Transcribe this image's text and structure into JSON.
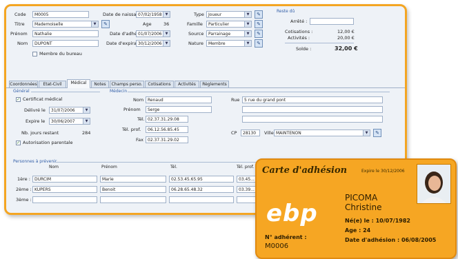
{
  "header": {
    "code_label": "Code",
    "code_value": "M0005",
    "titre_label": "Titre",
    "titre_value": "Mademoiselle",
    "prenom_label": "Prénom",
    "prenom_value": "Nathalie",
    "nom_label": "Nom",
    "nom_value": "DUPONT",
    "membre_bureau_label": "Membre du bureau",
    "naissance_label": "Date de naissance",
    "naissance_value": "07/02/1958",
    "age_label": "Age",
    "age_value": "36",
    "adhesion_label": "Date d'adhésion",
    "adhesion_value": "01/07/2006",
    "expiration_label": "Date d'expiration",
    "expiration_value": "30/12/2006",
    "type_label": "Type",
    "type_value": "Joueur",
    "famille_label": "Famille",
    "famille_value": "Particulier",
    "source_label": "Source",
    "source_value": "Parrainage",
    "nature_label": "Nature",
    "nature_value": "Membre"
  },
  "reste": {
    "title": "Reste dû",
    "arrete_label": "Arrêté :",
    "cotisations_label": "Cotisations :",
    "cotisations_value": "12,00 €",
    "activites_label": "Activités :",
    "activites_value": "20,00 €",
    "solde_label": "Solde :",
    "solde_value": "32,00 €"
  },
  "tabs": [
    "Coordonnées",
    "Etat-Civil",
    "Médical",
    "Notes",
    "Champs perso.",
    "Cotisations",
    "Activités",
    "Règlements"
  ],
  "active_tab": 2,
  "general": {
    "title": "Général",
    "certificat_label": "Certificat médical",
    "delivre_label": "Délivré le",
    "delivre_value": "31/07/2006",
    "expire_label": "Expire le",
    "expire_value": "30/06/2007",
    "jours_label": "Nb. jours restant",
    "jours_value": "284",
    "autorisation_label": "Autorisation parentale"
  },
  "medecin": {
    "title": "Médecin",
    "nom_label": "Nom",
    "nom_value": "Renaud",
    "prenom_label": "Prénom",
    "prenom_value": "Serge",
    "tel_label": "Tél.",
    "tel_value": "02.37.31.29.08",
    "telprof_label": "Tél. prof.",
    "telprof_value": "06.12.56.85.45",
    "fax_label": "Fax",
    "fax_value": "02.37.31.29.02",
    "rue_label": "Rue",
    "rue_value": "5 rue du grand pont",
    "cp_label": "CP",
    "cp_value": "28130",
    "ville_label": "Ville",
    "ville_value": "MAINTENON"
  },
  "prevenir": {
    "title": "Personnes à prévenir",
    "col_nom": "Nom",
    "col_prenom": "Prénom",
    "col_tel": "Tél.",
    "col_telprof": "Tél. prof.",
    "rows": [
      {
        "label": "1ère :",
        "nom": "DURCIM",
        "prenom": "Marie",
        "tel": "02.53.45.65.95",
        "telprof": "03.45..."
      },
      {
        "label": "2ème :",
        "nom": "KUPERS",
        "prenom": "Benoit",
        "tel": "06.28.65.48.32",
        "telprof": "03.39..."
      },
      {
        "label": "3ème :",
        "nom": "",
        "prenom": "",
        "tel": "",
        "telprof": ""
      }
    ]
  },
  "card": {
    "title": "Carte d'adhésion",
    "expire": "Expire le 30/12/2006",
    "logo": "ebp",
    "nom": "PICOMA",
    "prenom": "Christine",
    "ne": "Né(e) le : 10/07/1982",
    "age": "Age : 24",
    "adhesion": "Date d'adhésion : 06/08/2005",
    "adherent_label": "N° adhérent :",
    "adherent_value": "M0006"
  },
  "colors": {
    "frame": "#f4a522",
    "card": "#f6a623",
    "window": "#eef2f7",
    "accent": "#3460a8"
  }
}
